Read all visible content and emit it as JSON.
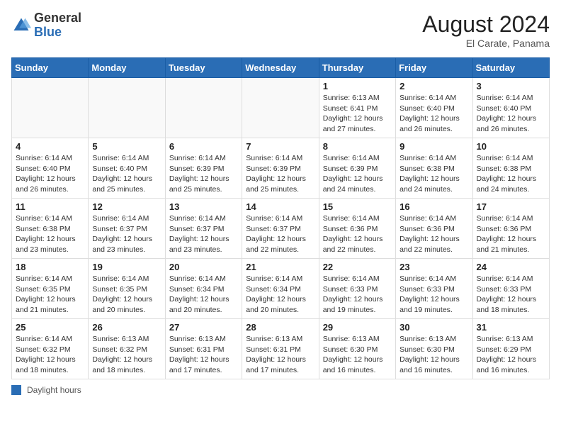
{
  "header": {
    "logo_general": "General",
    "logo_blue": "Blue",
    "month_year": "August 2024",
    "location": "El Carate, Panama"
  },
  "calendar": {
    "days_of_week": [
      "Sunday",
      "Monday",
      "Tuesday",
      "Wednesday",
      "Thursday",
      "Friday",
      "Saturday"
    ],
    "weeks": [
      [
        {
          "day": "",
          "info": ""
        },
        {
          "day": "",
          "info": ""
        },
        {
          "day": "",
          "info": ""
        },
        {
          "day": "",
          "info": ""
        },
        {
          "day": "1",
          "info": "Sunrise: 6:13 AM\nSunset: 6:41 PM\nDaylight: 12 hours\nand 27 minutes."
        },
        {
          "day": "2",
          "info": "Sunrise: 6:14 AM\nSunset: 6:40 PM\nDaylight: 12 hours\nand 26 minutes."
        },
        {
          "day": "3",
          "info": "Sunrise: 6:14 AM\nSunset: 6:40 PM\nDaylight: 12 hours\nand 26 minutes."
        }
      ],
      [
        {
          "day": "4",
          "info": "Sunrise: 6:14 AM\nSunset: 6:40 PM\nDaylight: 12 hours\nand 26 minutes."
        },
        {
          "day": "5",
          "info": "Sunrise: 6:14 AM\nSunset: 6:40 PM\nDaylight: 12 hours\nand 25 minutes."
        },
        {
          "day": "6",
          "info": "Sunrise: 6:14 AM\nSunset: 6:39 PM\nDaylight: 12 hours\nand 25 minutes."
        },
        {
          "day": "7",
          "info": "Sunrise: 6:14 AM\nSunset: 6:39 PM\nDaylight: 12 hours\nand 25 minutes."
        },
        {
          "day": "8",
          "info": "Sunrise: 6:14 AM\nSunset: 6:39 PM\nDaylight: 12 hours\nand 24 minutes."
        },
        {
          "day": "9",
          "info": "Sunrise: 6:14 AM\nSunset: 6:38 PM\nDaylight: 12 hours\nand 24 minutes."
        },
        {
          "day": "10",
          "info": "Sunrise: 6:14 AM\nSunset: 6:38 PM\nDaylight: 12 hours\nand 24 minutes."
        }
      ],
      [
        {
          "day": "11",
          "info": "Sunrise: 6:14 AM\nSunset: 6:38 PM\nDaylight: 12 hours\nand 23 minutes."
        },
        {
          "day": "12",
          "info": "Sunrise: 6:14 AM\nSunset: 6:37 PM\nDaylight: 12 hours\nand 23 minutes."
        },
        {
          "day": "13",
          "info": "Sunrise: 6:14 AM\nSunset: 6:37 PM\nDaylight: 12 hours\nand 23 minutes."
        },
        {
          "day": "14",
          "info": "Sunrise: 6:14 AM\nSunset: 6:37 PM\nDaylight: 12 hours\nand 22 minutes."
        },
        {
          "day": "15",
          "info": "Sunrise: 6:14 AM\nSunset: 6:36 PM\nDaylight: 12 hours\nand 22 minutes."
        },
        {
          "day": "16",
          "info": "Sunrise: 6:14 AM\nSunset: 6:36 PM\nDaylight: 12 hours\nand 22 minutes."
        },
        {
          "day": "17",
          "info": "Sunrise: 6:14 AM\nSunset: 6:36 PM\nDaylight: 12 hours\nand 21 minutes."
        }
      ],
      [
        {
          "day": "18",
          "info": "Sunrise: 6:14 AM\nSunset: 6:35 PM\nDaylight: 12 hours\nand 21 minutes."
        },
        {
          "day": "19",
          "info": "Sunrise: 6:14 AM\nSunset: 6:35 PM\nDaylight: 12 hours\nand 20 minutes."
        },
        {
          "day": "20",
          "info": "Sunrise: 6:14 AM\nSunset: 6:34 PM\nDaylight: 12 hours\nand 20 minutes."
        },
        {
          "day": "21",
          "info": "Sunrise: 6:14 AM\nSunset: 6:34 PM\nDaylight: 12 hours\nand 20 minutes."
        },
        {
          "day": "22",
          "info": "Sunrise: 6:14 AM\nSunset: 6:33 PM\nDaylight: 12 hours\nand 19 minutes."
        },
        {
          "day": "23",
          "info": "Sunrise: 6:14 AM\nSunset: 6:33 PM\nDaylight: 12 hours\nand 19 minutes."
        },
        {
          "day": "24",
          "info": "Sunrise: 6:14 AM\nSunset: 6:33 PM\nDaylight: 12 hours\nand 18 minutes."
        }
      ],
      [
        {
          "day": "25",
          "info": "Sunrise: 6:14 AM\nSunset: 6:32 PM\nDaylight: 12 hours\nand 18 minutes."
        },
        {
          "day": "26",
          "info": "Sunrise: 6:13 AM\nSunset: 6:32 PM\nDaylight: 12 hours\nand 18 minutes."
        },
        {
          "day": "27",
          "info": "Sunrise: 6:13 AM\nSunset: 6:31 PM\nDaylight: 12 hours\nand 17 minutes."
        },
        {
          "day": "28",
          "info": "Sunrise: 6:13 AM\nSunset: 6:31 PM\nDaylight: 12 hours\nand 17 minutes."
        },
        {
          "day": "29",
          "info": "Sunrise: 6:13 AM\nSunset: 6:30 PM\nDaylight: 12 hours\nand 16 minutes."
        },
        {
          "day": "30",
          "info": "Sunrise: 6:13 AM\nSunset: 6:30 PM\nDaylight: 12 hours\nand 16 minutes."
        },
        {
          "day": "31",
          "info": "Sunrise: 6:13 AM\nSunset: 6:29 PM\nDaylight: 12 hours\nand 16 minutes."
        }
      ]
    ]
  },
  "footer": {
    "label": "Daylight hours"
  }
}
